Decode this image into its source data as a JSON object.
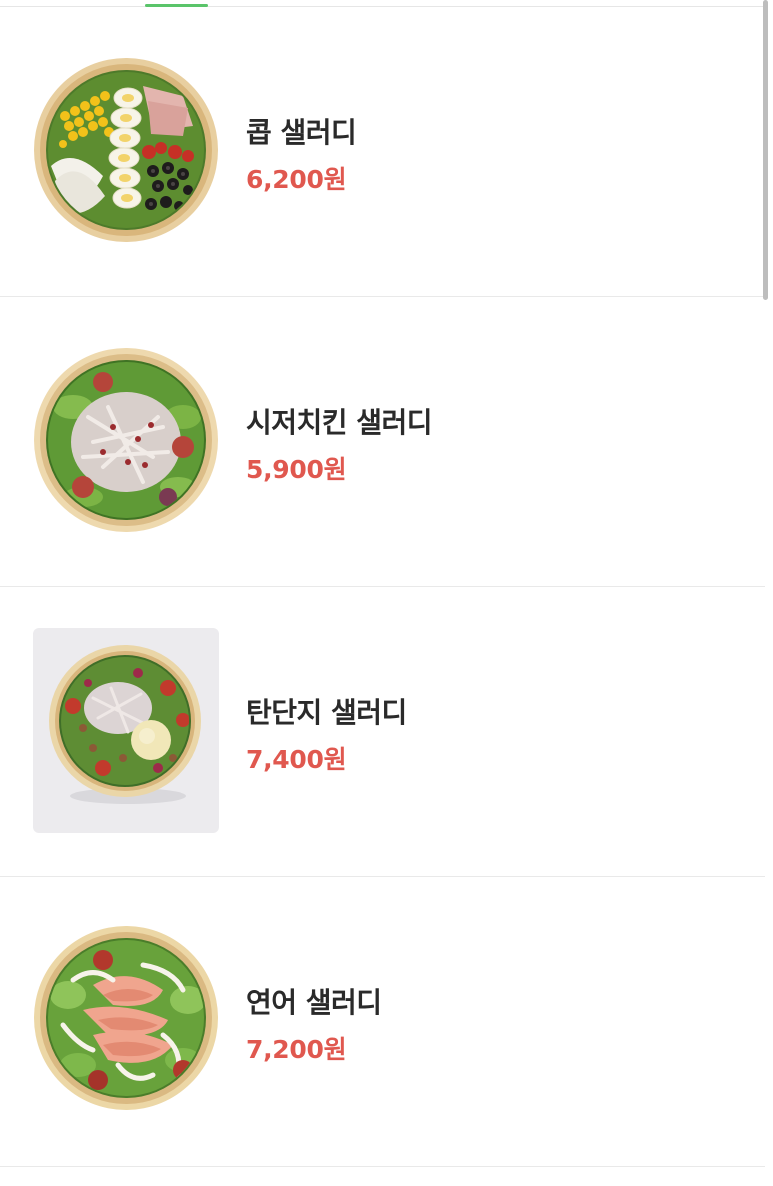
{
  "menu": {
    "items": [
      {
        "name": "콥 샐러디",
        "price": "6,200원",
        "image_icon": "cobb-salad-bowl-image"
      },
      {
        "name": "시저치킨 샐러디",
        "price": "5,900원",
        "image_icon": "caesar-chicken-salad-bowl-image"
      },
      {
        "name": "탄단지 샐러디",
        "price": "7,400원",
        "image_icon": "tandanji-salad-bowl-image"
      },
      {
        "name": "연어 샐러디",
        "price": "7,200원",
        "image_icon": "salmon-salad-bowl-image"
      }
    ]
  },
  "colors": {
    "price": "#e0584f",
    "active_tab": "#5ac46a",
    "divider": "#e9e9e9",
    "name": "#2a2a2a"
  }
}
